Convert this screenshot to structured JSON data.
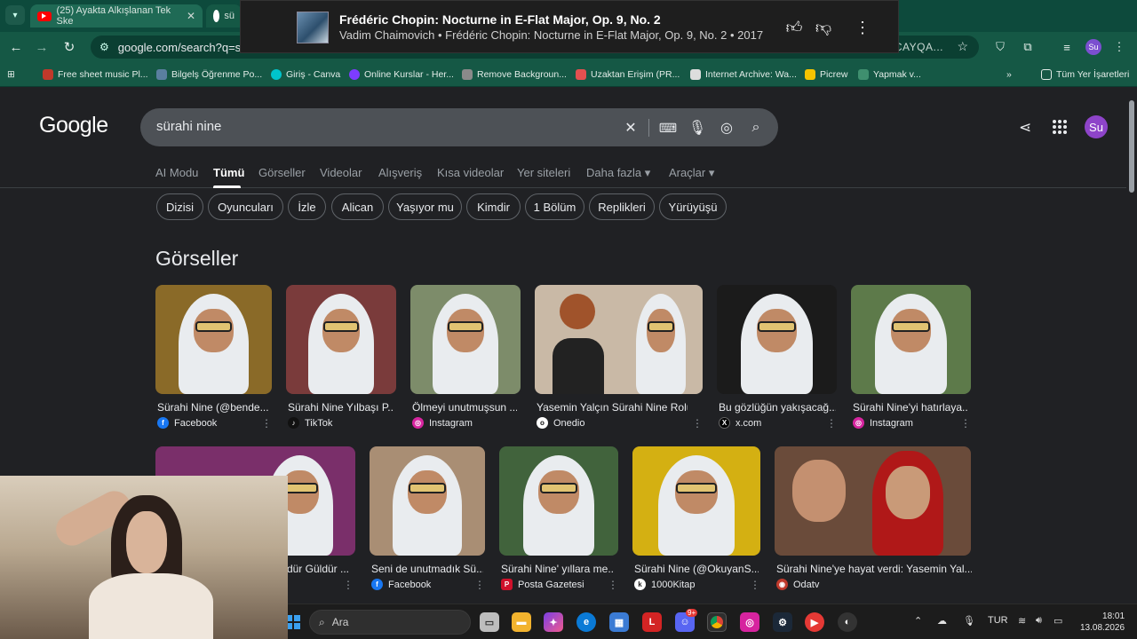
{
  "browser": {
    "tabs": [
      {
        "label": "(25) Ayakta Alkışlanan Tek Ske"
      },
      {
        "label": "sü"
      }
    ],
    "omnibox_url": "google.com/search?q=süra",
    "omnibox_tail": "HCAYQA...",
    "profile_initials": "Su",
    "bookmarks": [
      "Free sheet music Pl...",
      "Bilgelş Öğrenme Po...",
      "Giriş - Canva",
      "Online Kurslar - Her...",
      "Remove Backgroun...",
      "Uzaktan Erişim (PR...",
      "Internet Archive: Wa...",
      "Picrew",
      "Yapmak v..."
    ],
    "all_bookmarks": "Tüm Yer İşaretleri",
    "more_bookmarks": "»"
  },
  "media": {
    "title": "Frédéric Chopin: Nocturne in E-Flat Major, Op. 9, No. 2",
    "artist_line": "Vadim Chaimovich • Frédéric Chopin: Nocturne in E-Flat Major, Op. 9, No. 2 • 2017"
  },
  "google": {
    "logo": "Google",
    "query": "sürahi nine",
    "avatar": "Su",
    "tabs": [
      "AI Modu",
      "Tümü",
      "Görseller",
      "Videolar",
      "Alışveriş",
      "Kısa videolar",
      "Yer siteleri",
      "Daha fazla",
      "Araçlar"
    ],
    "chips": [
      "Dizisi",
      "Oyuncuları",
      "İzle",
      "Alican",
      "Yaşıyor mu",
      "Kimdir",
      "1 Bölüm",
      "Replikleri",
      "Yürüyüşü"
    ],
    "section_title": "Görseller",
    "images_row1": [
      {
        "caption": "Sürahi Nine (@bende...",
        "source": "Facebook",
        "color": "#1877f2"
      },
      {
        "caption": "Sürahi Nine Yılbaşı P...",
        "source": "TikTok",
        "color": "#111111"
      },
      {
        "caption": "Ölmeyi unutmuşsun ...",
        "source": "Instagram",
        "color": "#d6249f"
      },
      {
        "caption": "Yasemin Yalçın Sürahi Nine Rolün...",
        "source": "Onedio",
        "color": "#222222"
      },
      {
        "caption": "Bu gözlüğün yakışacağ...",
        "source": "x.com",
        "color": "#000000"
      },
      {
        "caption": "Sürahi Nine'yi hatırlaya...",
        "source": "Instagram",
        "color": "#d6249f"
      }
    ],
    "images_row2": [
      {
        "caption": "ldür Güldür ...",
        "source": "",
        "color": "#555555"
      },
      {
        "caption": "Seni de unutmadık Sü...",
        "source": "Facebook",
        "color": "#1877f2"
      },
      {
        "caption": "Sürahi Nine' yıllara me...",
        "source": "Posta Gazetesi",
        "color": "#d0112b"
      },
      {
        "caption": "Sürahi Nine (@OkuyanS...",
        "source": "1000Kitap",
        "color": "#333333"
      },
      {
        "caption": "Sürahi Nine'ye hayat verdi: Yasemin Yal...",
        "source": "Odatv",
        "color": "#c0392b"
      }
    ]
  },
  "taskbar": {
    "search_placeholder": "Ara",
    "language": "TUR",
    "time": "18:01",
    "date": "13.08.2026",
    "discord_badge": "9+"
  }
}
